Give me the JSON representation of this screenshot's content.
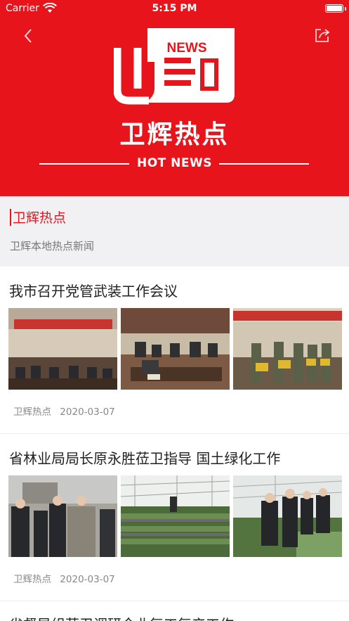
{
  "status_bar": {
    "carrier": "Carrier",
    "time": "5:15 PM"
  },
  "banner": {
    "logo_text": "NEWS",
    "title": "卫辉热点",
    "subtitle": "HOT NEWS",
    "color": "#e8141c"
  },
  "section": {
    "title": "卫辉热点",
    "description": "卫辉本地热点新闻"
  },
  "articles": [
    {
      "headline": "我市召开党管武装工作会议",
      "source": "卫辉热点",
      "date": "2020-03-07"
    },
    {
      "headline": "省林业局局长原永胜莅卫指导 国土绿化工作",
      "source": "卫辉热点",
      "date": "2020-03-07"
    },
    {
      "headline": "省督导组莅卫调研企业复工复产工作"
    }
  ]
}
